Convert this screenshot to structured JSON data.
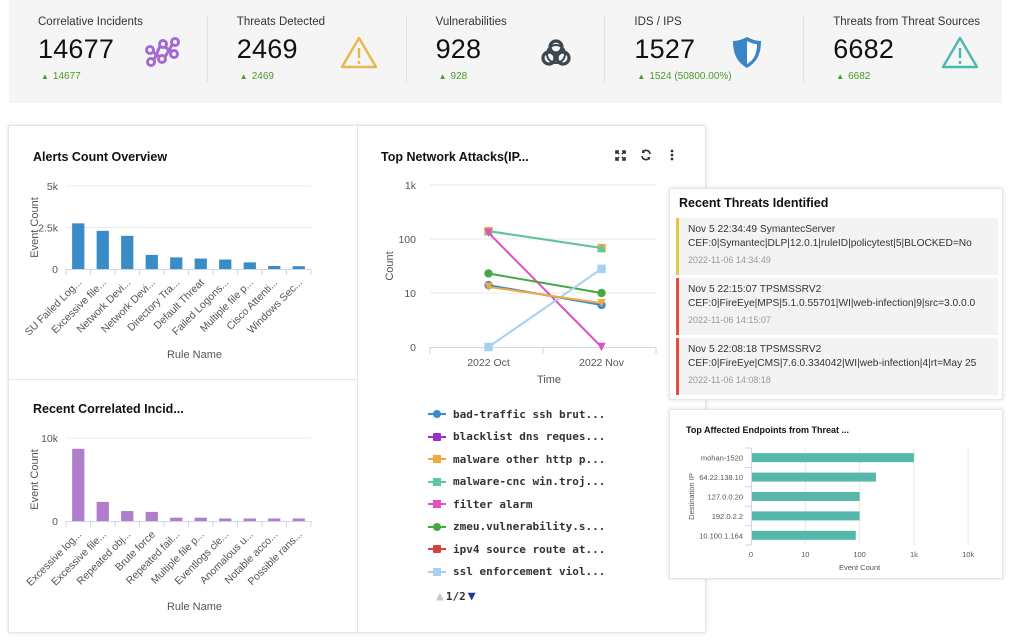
{
  "kpis": [
    {
      "title": "Correlative Incidents",
      "value": "14677",
      "delta": "14677",
      "icon": "graph-nodes-icon",
      "icon_color": "#a46ad2"
    },
    {
      "title": "Threats Detected",
      "value": "2469",
      "delta": "2469",
      "icon": "warning-triangle-icon",
      "icon_color": "#e8b84a"
    },
    {
      "title": "Vulnerabilities",
      "value": "928",
      "delta": "928",
      "icon": "biohazard-icon",
      "icon_color": "#3c4650"
    },
    {
      "title": "IDS / IPS",
      "value": "1527",
      "delta": "1524 (50800.00%)",
      "icon": "shield-icon",
      "icon_color": "#3a85c8"
    },
    {
      "title": "Threats from Threat Sources",
      "value": "6682",
      "delta": "6682",
      "icon": "warning-triangle-icon",
      "icon_color": "#4bb8ad"
    }
  ],
  "delta_up_glyph": "▲",
  "colors": {
    "positive": "#4a9a2a",
    "bar_blue": "#3a8cc8",
    "bar_purple": "#b07ccc",
    "bar_teal": "#55b8aa",
    "severity_medium": "#e6c840",
    "severity_high": "#e74c3c"
  },
  "chart_data": [
    {
      "id": "alerts",
      "type": "bar",
      "title": "Alerts Count Overview",
      "xlabel": "Rule Name",
      "ylabel": "Event Count",
      "ylim": [
        0,
        5000
      ],
      "yticks": [
        {
          "v": 0,
          "label": "0"
        },
        {
          "v": 2500,
          "label": "2.5k"
        },
        {
          "v": 5000,
          "label": "5k"
        }
      ],
      "categories": [
        "SU Failed Log...",
        "Excessive file...",
        "Network Devi...",
        "Network Devi...",
        "Directory Tra...",
        "Default Threat",
        "Failed Logons...",
        "Multiple file p...",
        "Cisco Attenti...",
        "Windows Sec..."
      ],
      "values": [
        2750,
        2300,
        2000,
        850,
        700,
        630,
        570,
        400,
        180,
        170
      ],
      "color": "#3a8cc8",
      "grid": true
    },
    {
      "id": "correlated",
      "type": "bar",
      "title": "Recent Correlated Incid...",
      "xlabel": "Rule Name",
      "ylabel": "Event Count",
      "ylim": [
        0,
        10000
      ],
      "yticks": [
        {
          "v": 0,
          "label": "0"
        },
        {
          "v": 10000,
          "label": "10k"
        }
      ],
      "categories": [
        "Excessive log...",
        "Excessive file...",
        "Repeated obj...",
        "Brute force",
        "Repeated fail...",
        "Multiple file p...",
        "Eventlogs cle...",
        "Anomalous u...",
        "Notable acco...",
        "Possible rans..."
      ],
      "values": [
        8700,
        2300,
        1200,
        1100,
        400,
        400,
        300,
        300,
        300,
        300
      ],
      "color": "#b07ccc",
      "grid": true
    },
    {
      "id": "network",
      "type": "line",
      "title": "Top Network Attacks(IP...",
      "xlabel": "Time",
      "ylabel": "Count",
      "yscale": "log",
      "ylim": [
        0,
        1000
      ],
      "yticks": [
        {
          "v": 0,
          "label": "0"
        },
        {
          "v": 10,
          "label": "10"
        },
        {
          "v": 100,
          "label": "100"
        },
        {
          "v": 1000,
          "label": "1k"
        }
      ],
      "x": [
        "2022 Oct",
        "2022 Nov"
      ],
      "series": [
        {
          "name": "bad-traffic ssh brut...",
          "color": "#3a8cc8",
          "marker": "circle",
          "values": [
            14,
            6
          ]
        },
        {
          "name": "blacklist dns reques...",
          "color": "#9b30d0",
          "marker": "diamond",
          "values": [
            null,
            null
          ]
        },
        {
          "name": "malware other http p...",
          "color": "#f0a840",
          "marker": "square",
          "values": [
            140,
            68
          ]
        },
        {
          "name": "malware-cnc win.troj...",
          "color": "#5cc8a0",
          "marker": "triangle",
          "values": [
            140,
            68
          ]
        },
        {
          "name": "filter alarm",
          "color": "#e050c0",
          "marker": "triangle-down",
          "values": [
            130,
            0
          ]
        },
        {
          "name": "zmeu.vulnerability.s...",
          "color": "#44a844",
          "marker": "circle",
          "values": [
            23,
            10
          ]
        },
        {
          "name": "ipv4 source route at...",
          "color": "#d84040",
          "marker": "diamond",
          "values": [
            null,
            null
          ]
        },
        {
          "name": "ssl enforcement viol...",
          "color": "#a8d0f0",
          "marker": "square",
          "values": [
            0,
            28
          ]
        },
        {
          "name": "orange-triangle-down-series",
          "color": "#f0a840",
          "marker": "triangle-down",
          "values": [
            13,
            6.5
          ],
          "hidden_legend": true
        }
      ],
      "legend_position": "bottom",
      "legend_page": "1/2",
      "grid": true
    },
    {
      "id": "endpoints",
      "type": "bar",
      "orientation": "horizontal",
      "title": "Top Affected Endpoints from Threat ...",
      "xlabel": "Event Count",
      "ylabel": "Destination IP",
      "xscale": "log",
      "xlim": [
        0,
        10000
      ],
      "xticks": [
        {
          "v": 0,
          "label": "0"
        },
        {
          "v": 10,
          "label": "10"
        },
        {
          "v": 100,
          "label": "100"
        },
        {
          "v": 1000,
          "label": "1k"
        },
        {
          "v": 10000,
          "label": "10k"
        }
      ],
      "categories": [
        "mohan-1520",
        "64.22.138.10",
        "127.0.0.20",
        "192.0.2.2",
        "10.100.1.164"
      ],
      "values": [
        1000,
        200,
        100,
        100,
        85
      ],
      "color": "#55b8aa",
      "grid": true
    }
  ],
  "threats": {
    "title": "Recent Threats Identified",
    "items": [
      {
        "line1": "Nov 5 22:34:49 SymantecServer",
        "line2": "CEF:0|Symantec|DLP|12.0.1|ruleID|policytest|5|BLOCKED=No",
        "time": "2022-11-06 14:34:49",
        "severity_color": "#e6c840"
      },
      {
        "line1": "Nov 5 22:15:07 TPSMSSRV2",
        "line2": "CEF:0|FireEye|MPS|5.1.0.55701|WI|web-infection|9|src=3.0.0.0",
        "time": "2022-11-06 14:15:07",
        "severity_color": "#e74c3c"
      },
      {
        "line1": "Nov 5 22:08:18 TPSMSSRV2",
        "line2": "CEF:0|FireEye|CMS|7.6.0.334042|WI|web-infection|4|rt=May 25",
        "time": "2022-11-06 14:08:18",
        "severity_color": "#e74c3c"
      }
    ]
  },
  "toolbar": {
    "expand_icon": "expand-icon",
    "refresh_icon": "refresh-icon",
    "more_icon": "more-vertical-icon"
  }
}
